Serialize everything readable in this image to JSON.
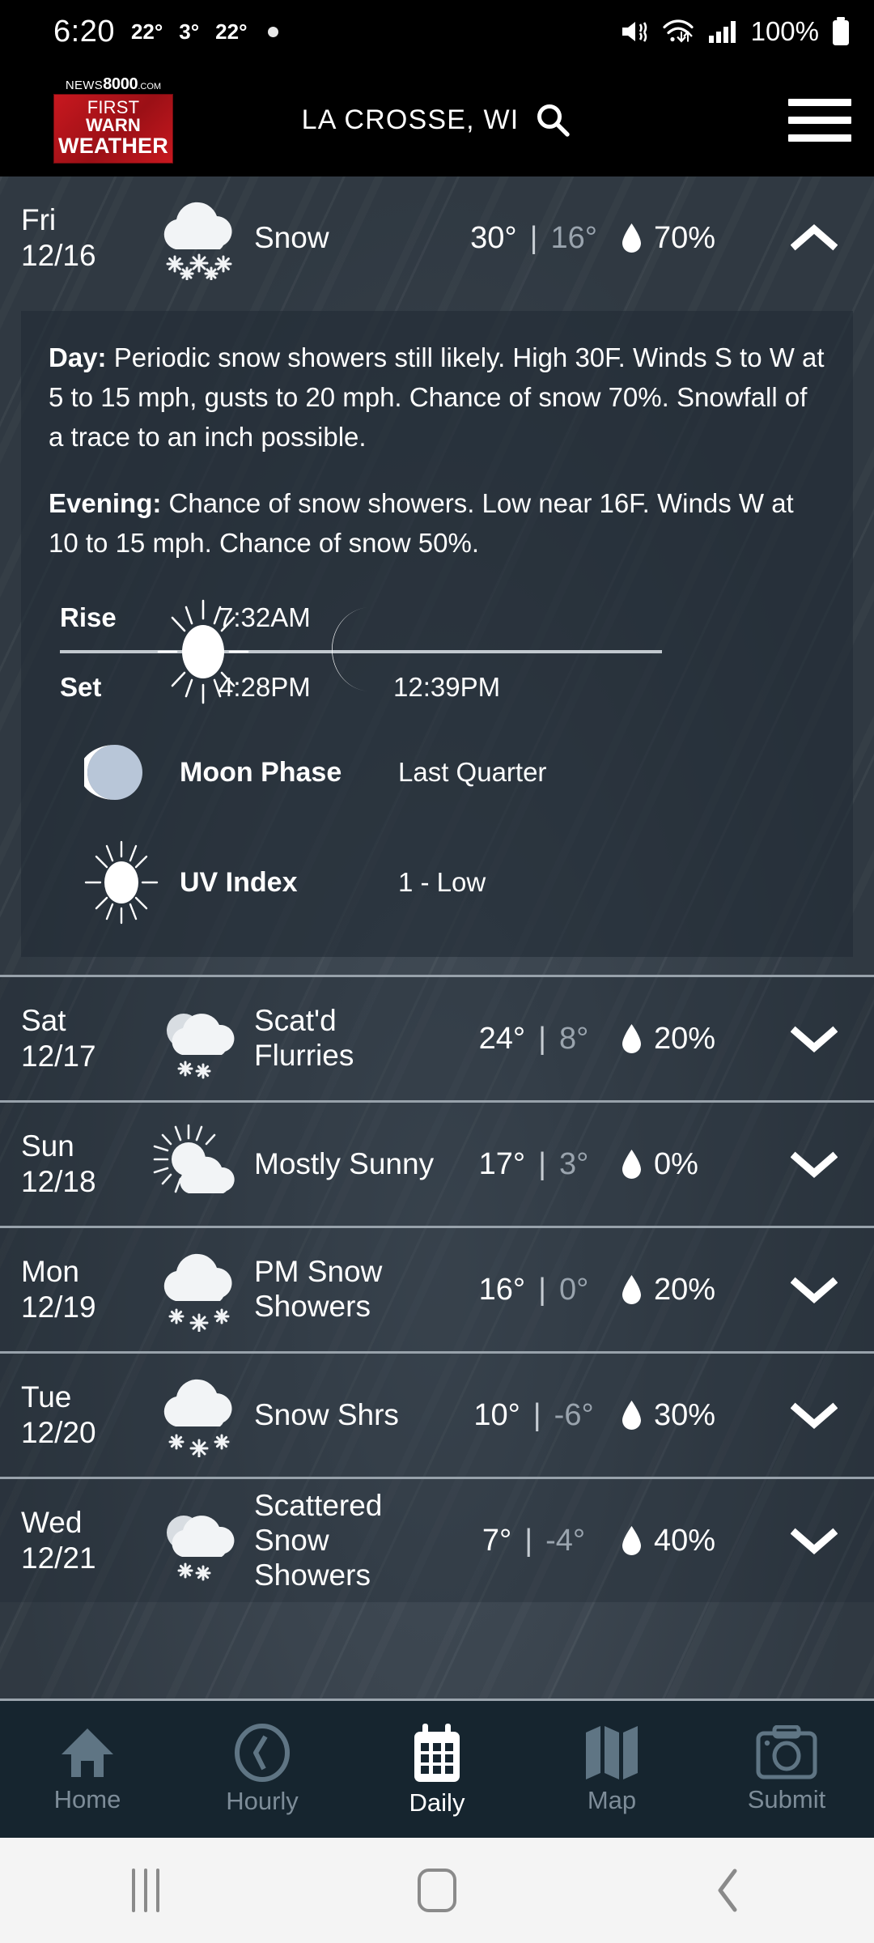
{
  "status_bar": {
    "time": "6:20",
    "temps": [
      "22°",
      "3°",
      "22°"
    ],
    "battery_percent": "100%",
    "icons": [
      "mute-icon",
      "wifi-icon",
      "signal-icon",
      "battery-icon"
    ]
  },
  "header": {
    "logo": {
      "news_word": "NEWS",
      "news_num": "8000",
      "news_tld": ".COM",
      "line1_first": "FIRST",
      "line1_warn": "WARN",
      "line2": "WEATHER"
    },
    "location": "LA CROSSE, WI",
    "search_icon": "search-icon",
    "menu_icon": "hamburger-menu-icon"
  },
  "forecast": {
    "days": [
      {
        "day": "Fri",
        "date": "12/16",
        "condition": "Snow",
        "high": "30°",
        "low": "16°",
        "separator": "|",
        "precip": "70%",
        "icon": "snow-icon",
        "expanded": true,
        "chevron": "chevron-up-icon",
        "detail": {
          "day_label": "Day:",
          "day_text": "Periodic snow showers still likely. High 30F. Winds S to W at 5 to 15 mph, gusts to 20 mph. Chance of snow 70%. Snowfall of a trace to an inch possible.",
          "evening_label": "Evening:",
          "evening_text": "Chance of snow showers. Low near 16F. Winds W at 10 to 15 mph. Chance of snow 50%.",
          "rise_label": "Rise",
          "set_label": "Set",
          "sun_rise": "7:32AM",
          "sun_set": "4:28PM",
          "moon_time": "12:39PM",
          "moon_phase_label": "Moon Phase",
          "moon_phase_value": "Last Quarter",
          "uv_label": "UV Index",
          "uv_value": "1 - Low"
        }
      },
      {
        "day": "Sat",
        "date": "12/17",
        "condition": "Scat'd Flurries",
        "high": "24°",
        "low": "8°",
        "separator": "|",
        "precip": "20%",
        "icon": "partly-cloudy-snow-icon",
        "expanded": false,
        "chevron": "chevron-down-icon"
      },
      {
        "day": "Sun",
        "date": "12/18",
        "condition": "Mostly Sunny",
        "high": "17°",
        "low": "3°",
        "separator": "|",
        "precip": "0%",
        "icon": "sun-cloud-icon",
        "expanded": false,
        "chevron": "chevron-down-icon"
      },
      {
        "day": "Mon",
        "date": "12/19",
        "condition": "PM Snow Showers",
        "high": "16°",
        "low": "0°",
        "separator": "|",
        "precip": "20%",
        "icon": "snow-icon",
        "expanded": false,
        "chevron": "chevron-down-icon"
      },
      {
        "day": "Tue",
        "date": "12/20",
        "condition": "Snow Shrs",
        "high": "10°",
        "low": "-6°",
        "separator": "|",
        "precip": "30%",
        "icon": "snow-icon",
        "expanded": false,
        "chevron": "chevron-down-icon"
      },
      {
        "day": "Wed",
        "date": "12/21",
        "condition": "Scattered Snow Showers",
        "high": "7°",
        "low": "-4°",
        "separator": "|",
        "precip": "40%",
        "icon": "partly-cloudy-snow-icon",
        "expanded": false,
        "chevron": "chevron-down-icon"
      }
    ]
  },
  "tabbar": {
    "items": [
      {
        "label": "Home",
        "icon": "home-icon",
        "active": false
      },
      {
        "label": "Hourly",
        "icon": "clock-icon",
        "active": false
      },
      {
        "label": "Daily",
        "icon": "calendar-icon",
        "active": true
      },
      {
        "label": "Map",
        "icon": "map-icon",
        "active": false
      },
      {
        "label": "Submit",
        "icon": "camera-icon",
        "active": false
      }
    ]
  },
  "android_nav": {
    "recents": "recents-icon",
    "home": "home-button-icon",
    "back": "back-icon"
  },
  "colors": {
    "brand_red": "#c8181f",
    "panel": "#39444f",
    "tabbar": "#16252f",
    "accent_text": "#ffffff"
  }
}
